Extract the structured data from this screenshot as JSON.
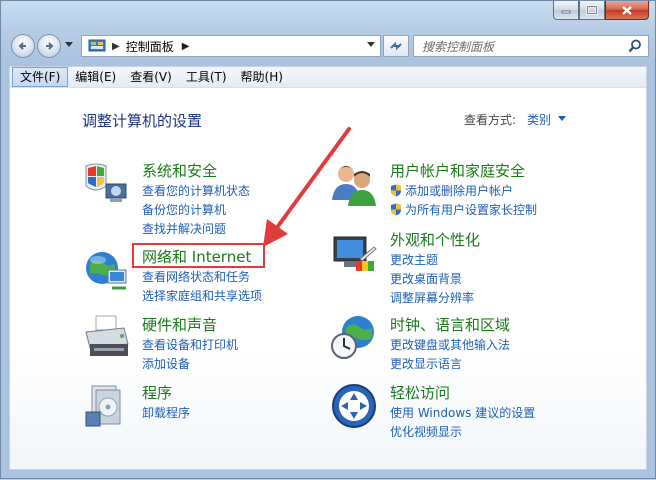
{
  "window": {
    "caption_buttons": [
      "minimize-icon",
      "maximize-icon",
      "close-icon"
    ]
  },
  "address_bar": {
    "breadcrumb": "控制面板",
    "search_placeholder": "搜索控制面板"
  },
  "menu": {
    "items": [
      {
        "label": "文件(F)",
        "active": true
      },
      {
        "label": "编辑(E)"
      },
      {
        "label": "查看(V)"
      },
      {
        "label": "工具(T)"
      },
      {
        "label": "帮助(H)"
      }
    ]
  },
  "main": {
    "title": "调整计算机的设置",
    "view_by_label": "查看方式:",
    "view_by_value": "类别"
  },
  "categories": [
    {
      "title": "系统和安全",
      "icon": "shield-pc-icon",
      "links": [
        "查看您的计算机状态",
        "备份您的计算机",
        "查找并解决问题"
      ]
    },
    {
      "title": "网络和 Internet",
      "icon": "network-globe-icon",
      "links": [
        "查看网络状态和任务",
        "选择家庭组和共享选项"
      ],
      "highlighted": true
    },
    {
      "title": "硬件和声音",
      "icon": "printer-icon",
      "links": [
        "查看设备和打印机",
        "添加设备"
      ]
    },
    {
      "title": "程序",
      "icon": "programs-icon",
      "links": [
        "卸载程序"
      ]
    },
    {
      "title": "用户帐户和家庭安全",
      "icon": "users-icon",
      "links": [
        "添加或删除用户帐户",
        "为所有用户设置家长控制"
      ],
      "link_icons": [
        "uac-shield-icon",
        "uac-shield-icon"
      ]
    },
    {
      "title": "外观和个性化",
      "icon": "monitor-paint-icon",
      "links": [
        "更改主题",
        "更改桌面背景",
        "调整屏幕分辨率"
      ]
    },
    {
      "title": "时钟、语言和区域",
      "icon": "clock-globe-icon",
      "links": [
        "更改键盘或其他输入法",
        "更改显示语言"
      ]
    },
    {
      "title": "轻松访问",
      "icon": "ease-of-access-icon",
      "links": [
        "使用 Windows 建议的设置",
        "优化视频显示"
      ]
    }
  ],
  "annotation": {
    "color": "#e23b3b"
  }
}
